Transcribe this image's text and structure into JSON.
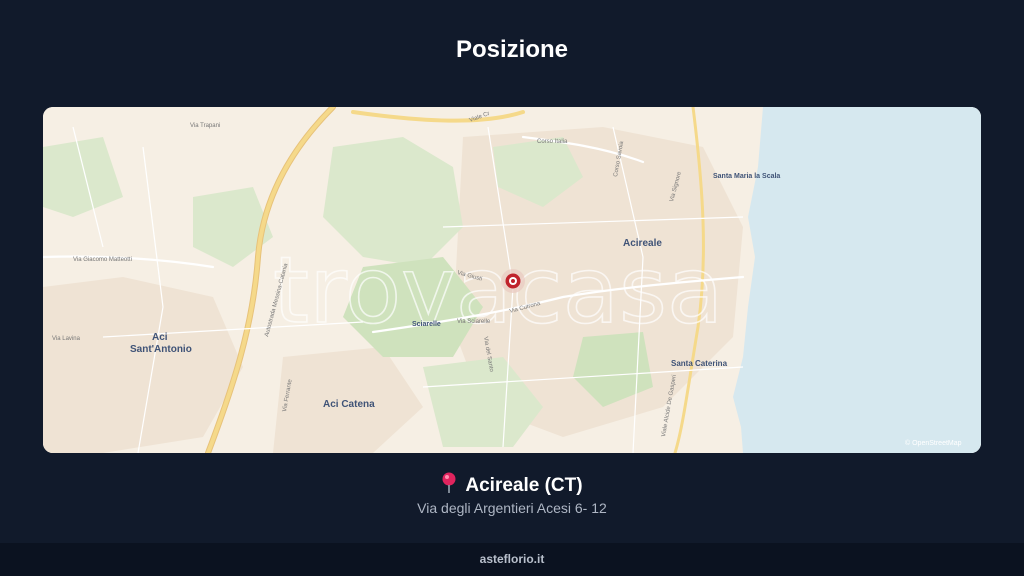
{
  "header": {
    "title": "Posizione"
  },
  "map": {
    "attribution": "© OpenStreetMap",
    "watermark": "trovacasa",
    "marker_icon": "location-marker-icon",
    "colors": {
      "sea": "#d6e8ef",
      "land": "#f6efe4",
      "park": "#dbe8cc",
      "marker": "#c0232c"
    },
    "places": {
      "acireale": "Acireale",
      "santa_maria_la_scala": "Santa Maria la Scala",
      "santa_caterina": "Santa Caterina",
      "aci_sant_antonio_1": "Aci",
      "aci_sant_antonio_2": "Sant'Antonio",
      "aci_catena": "Aci Catena",
      "sciarelle": "Sciarelle"
    },
    "streets": {
      "viale_c": "Viale Cr",
      "via_giacomo_matteotti": "Via Giacomo Matteotti",
      "via_sciarelle": "Via Sciarelle",
      "via_giusti": "Via Giusti",
      "via_cutrona": "Via Cutrona",
      "corso_italia": "Corso Italia",
      "viale_alcide_de_gasperi": "Viale Alcide De Gasperi",
      "autostrada": "Autostrada Messina-Catania",
      "via_trapani": "Via Trapani",
      "via_lavina": "Via Lavina",
      "via_ferrante": "Via Ferrante",
      "corso_savoia": "Corso Savoia",
      "via_signore": "Via Signore",
      "via_del_santo": "Via del Santo"
    }
  },
  "location": {
    "pin_icon": "pin-icon",
    "city": "Acireale (CT)",
    "address": "Via degli Argentieri Acesi 6- 12"
  },
  "footer": {
    "site": "asteflorio.it"
  }
}
